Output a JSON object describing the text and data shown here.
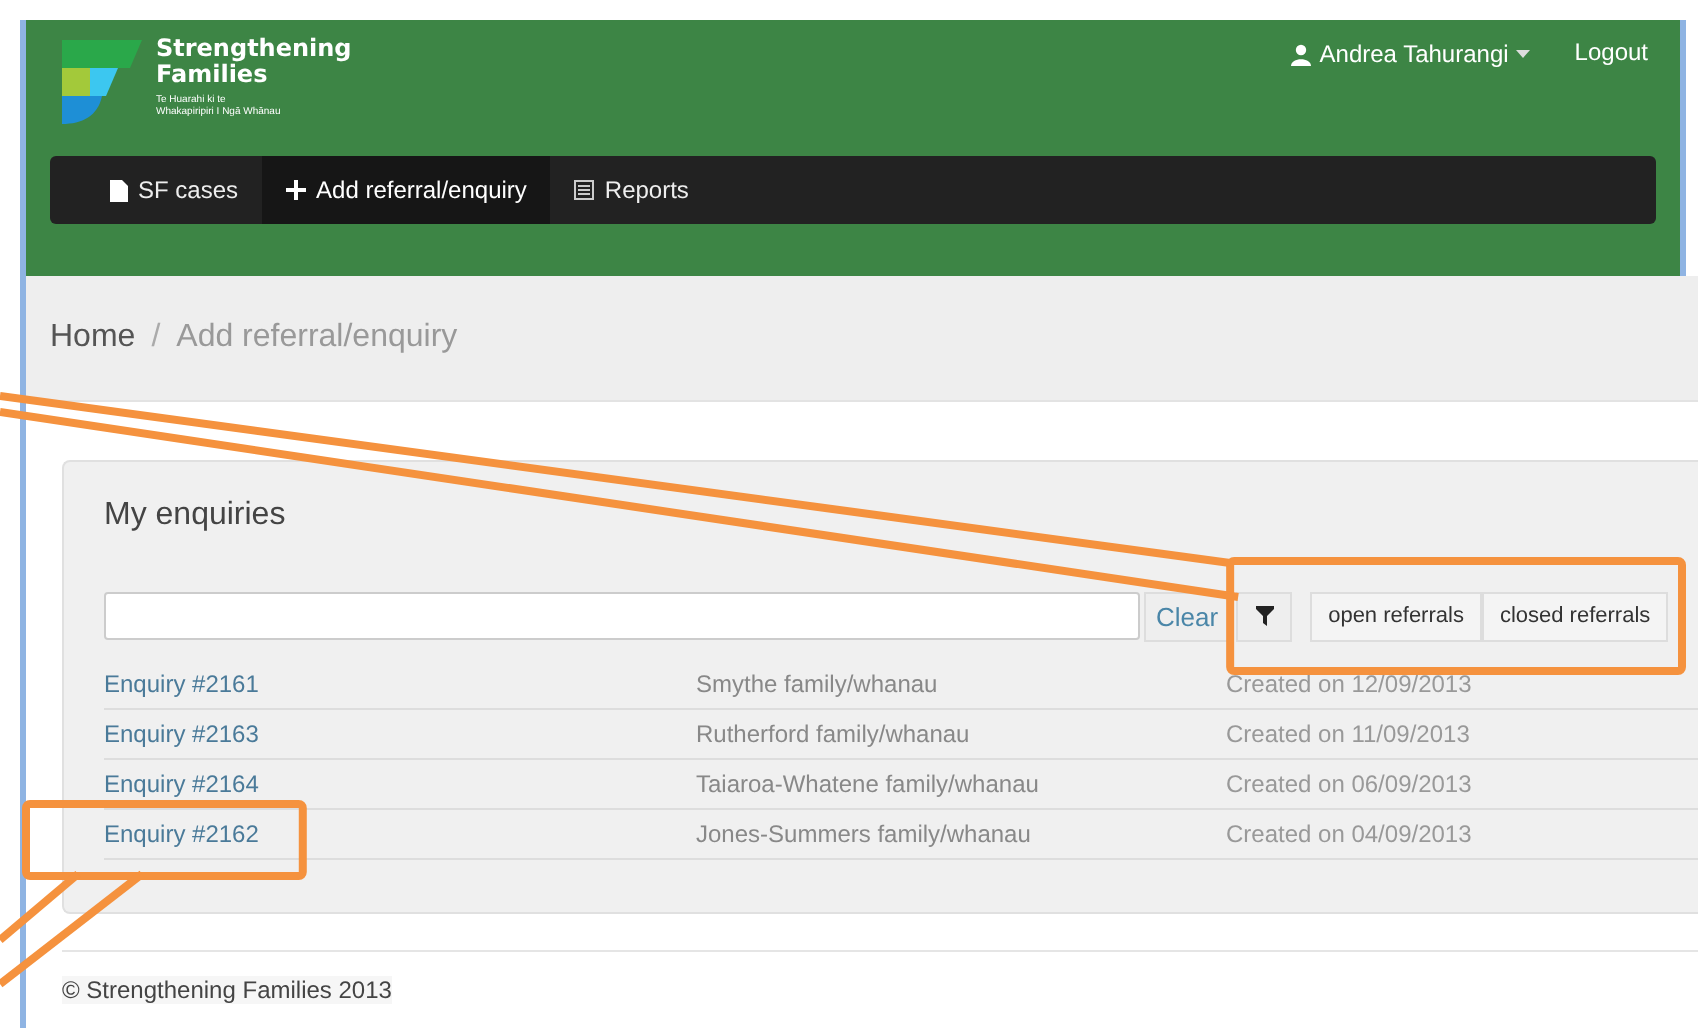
{
  "header": {
    "logo": {
      "title_lines": [
        "Strengthening",
        "Families"
      ],
      "subtitle_lines": [
        "Te Huarahi ki te",
        "Whakapiripiri I Ngā Whānau"
      ]
    },
    "user_menu": "Andrea Tahurangi",
    "logout": "Logout"
  },
  "nav": [
    {
      "label": "SF cases",
      "selected": false
    },
    {
      "label": "Add referral/enquiry",
      "selected": true
    },
    {
      "label": "Reports",
      "selected": false
    }
  ],
  "breadcrumb_separator": "/",
  "breadcrumb": [
    {
      "label": "Home",
      "current": false
    },
    {
      "label": "Add referral/enquiry",
      "current": true
    }
  ],
  "panel": {
    "title": "My enquiries",
    "clear_button": "Clear",
    "toolbar_highlighted": true,
    "filters": [
      {
        "label": "open referrals"
      },
      {
        "label": "closed referrals"
      }
    ],
    "rows": [
      {
        "link": "Enquiry #2161",
        "family": "Smythe family/whanau",
        "created": "Created on 12/09/2013",
        "highlighted": false
      },
      {
        "link": "Enquiry #2163",
        "family": "Rutherford family/whanau",
        "created": "Created on 11/09/2013",
        "highlighted": false
      },
      {
        "link": "Enquiry #2164",
        "family": "Taiaroa-Whatene family/whanau",
        "created": "Created on 06/09/2013",
        "highlighted": false
      },
      {
        "link": "Enquiry #2162",
        "family": "Jones-Summers family/whanau",
        "created": "Created on 04/09/2013",
        "highlighted": true
      }
    ]
  },
  "footer": "© Strengthening Families 2013"
}
